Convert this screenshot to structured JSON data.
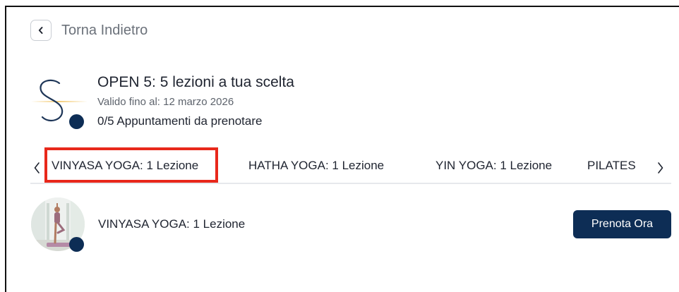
{
  "back": {
    "label": "Torna Indietro"
  },
  "package": {
    "title": "OPEN 5: 5 lezioni a tua scelta",
    "valid_until": "Valido fino al: 12 marzo 2026",
    "appointments": "0/5 Appuntamenti da prenotare"
  },
  "tabs": [
    {
      "label": "VINYASA YOGA: 1 Lezione",
      "selected": true
    },
    {
      "label": "HATHA YOGA: 1 Lezione",
      "selected": false
    },
    {
      "label": "YIN YOGA: 1 Lezione",
      "selected": false
    },
    {
      "label": "PILATES",
      "selected": false
    }
  ],
  "lesson": {
    "name": "VINYASA YOGA: 1 Lezione",
    "book_label": "Prenota Ora"
  },
  "colors": {
    "brand_navy": "#0d2d55",
    "highlight_red": "#e8281b",
    "logo_gold": "#f2c76a"
  },
  "icons": {
    "back": "chevron-left-icon",
    "tabs_prev": "chevron-left-icon",
    "tabs_next": "chevron-right-icon"
  }
}
